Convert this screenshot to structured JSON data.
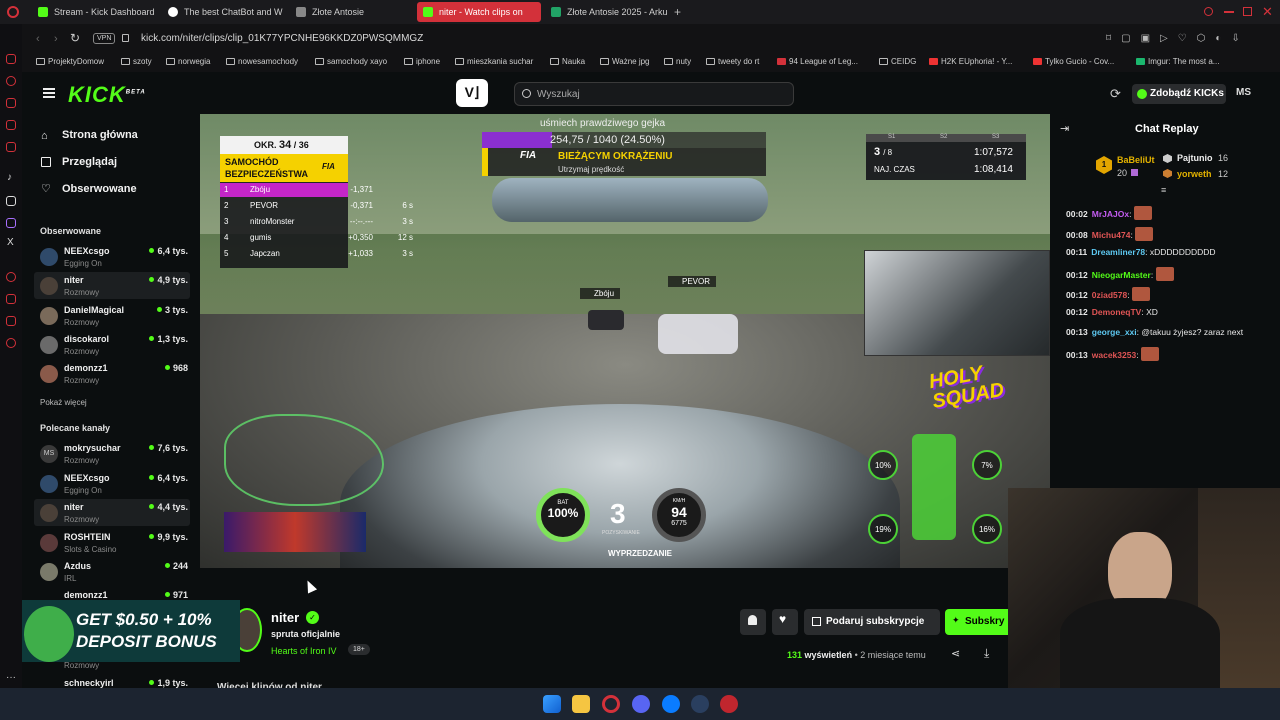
{
  "browser": {
    "tabs": [
      {
        "label": "Stream - Kick Dashboard",
        "color": "#53fc18",
        "active": false
      },
      {
        "label": "The best ChatBot and W",
        "color": "#ffffff",
        "active": false
      },
      {
        "label": "Złote Antosie",
        "color": "#d6d6d6",
        "active": false
      },
      {
        "label": "niter - Watch clips on",
        "color": "#53fc18",
        "active": true
      },
      {
        "label": "Złote Antosie 2025 - Arku",
        "color": "#21a366",
        "active": false
      }
    ],
    "new_tab": "+",
    "vpn": "VPN",
    "url": "kick.com/niter/clips/clip_01K77YPCNHE96KKDZ0PWSQMMGZ",
    "bookmarks": [
      "ProjektyDomow",
      "szoty",
      "norwegia",
      "nowesamochody",
      "samochody xayo",
      "iphone",
      "mieszkania suchar",
      "Nauka",
      "Ważne jpg",
      "nuty",
      "tweety do rt",
      "94 League of Leg...",
      "CEIDG",
      "H2K EUphoria! - Y...",
      "Tylko Gucio - Cov...",
      "Imgur: The most a..."
    ]
  },
  "header": {
    "logo": "KICK",
    "logo_badge": "BETA",
    "search_placeholder": "Wyszukaj",
    "kicks_button": "Zdobądź KICKs",
    "avatar_initials": "MS"
  },
  "sidebar": {
    "nav": [
      "Strona główna",
      "Przeglądaj",
      "Obserwowane"
    ],
    "followed_title": "Obserwowane",
    "followed": [
      {
        "name": "NEEXcsgo",
        "category": "Egging On",
        "viewers": "6,4 tys."
      },
      {
        "name": "niter",
        "category": "Rozmowy",
        "viewers": "4,9 tys."
      },
      {
        "name": "DanielMagical",
        "category": "Rozmowy",
        "viewers": "3 tys."
      },
      {
        "name": "discokarol",
        "category": "Rozmowy",
        "viewers": "1,3 tys."
      },
      {
        "name": "demonzz1",
        "category": "Rozmowy",
        "viewers": "968"
      }
    ],
    "show_more": "Pokaż więcej",
    "recommended_title": "Polecane kanały",
    "recommended": [
      {
        "name": "mokrysuchar",
        "category": "Rozmowy",
        "viewers": "7,6 tys."
      },
      {
        "name": "NEEXcsgo",
        "category": "Egging On",
        "viewers": "6,4 tys."
      },
      {
        "name": "niter",
        "category": "Rozmowy",
        "viewers": "4,4 tys."
      },
      {
        "name": "ROSHTEIN",
        "category": "Slots & Casino",
        "viewers": "9,9 tys."
      },
      {
        "name": "Azdus",
        "category": "IRL",
        "viewers": "244"
      },
      {
        "name": "demonzz1",
        "category": "Rozmowy",
        "viewers": "971"
      },
      {
        "name": "schneckyirl",
        "category": "",
        "viewers": "1,9 tys."
      }
    ]
  },
  "ad": {
    "line1": "GET $0.50 + 10%",
    "line2": "DEPOSIT BONUS"
  },
  "video": {
    "lap_label": "OKR.",
    "lap": "34",
    "lap_total": "/ 36",
    "safety_car": "SAMOCHÓD BEZPIECZEŃSTWA",
    "alert_top": "uśmiech prawdziwego gejka",
    "alert_amount": "254,75 / 1040 (24.50%)",
    "alert_title": "BIEŻĄCYM OKRĄŻENIU",
    "alert_sub": "Utrzymaj prędkość",
    "standings": [
      {
        "pos": "1",
        "name": "Zbóju",
        "gap": "-1,371",
        "tyre": ""
      },
      {
        "pos": "2",
        "name": "PEVOR",
        "gap": "-0,371",
        "tyre": "6 s"
      },
      {
        "pos": "3",
        "name": "nitroMonster",
        "gap": "--:--.---",
        "tyre": "3 s"
      },
      {
        "pos": "4",
        "name": "gumis",
        "gap": "+0,350",
        "tyre": "12 s"
      },
      {
        "pos": "5",
        "name": "Japczan",
        "gap": "+1,033",
        "tyre": "3 s"
      }
    ],
    "sectors": [
      "S1",
      "S2",
      "S3"
    ],
    "position": "3",
    "position_total": "/ 8",
    "lap_time": "1:07,572",
    "best_label": "NAJ. CZAS",
    "best_time": "1:08,414",
    "car_tag_1": "PEVOR",
    "car_tag_2": "Zbóju",
    "battery": "100%",
    "battery_label": "BAT",
    "gear": "3",
    "speed": "94",
    "speed_unit": "KM/H",
    "rpm": "6775",
    "ers_mode": "POZYSKIWANIE",
    "overtake": "WYPRZEDZANIE",
    "tyre_wear": [
      "10%",
      "7%",
      "19%",
      "16%"
    ],
    "team_logo": "HOLY SQUAD"
  },
  "chat": {
    "title": "Chat Replay",
    "gifters": [
      {
        "name": "BaBeliUt",
        "count": "20"
      },
      {
        "name": "Pajtunio",
        "count": "16"
      },
      {
        "name": "yorweth",
        "count": "12"
      }
    ],
    "messages": [
      {
        "time": "00:02",
        "user": "MrJAJOx",
        "color": "#c45cf2",
        "text": ""
      },
      {
        "time": "00:08",
        "user": "Michu474",
        "color": "#e05555",
        "text": ""
      },
      {
        "time": "00:11",
        "user": "Dreamliner78",
        "color": "#5ec9f2",
        "text": "xDDDDDDDDDD"
      },
      {
        "time": "00:12",
        "user": "NieogarMaster",
        "color": "#53fc18",
        "text": ""
      },
      {
        "time": "00:12",
        "user": "0ziad578",
        "color": "#e05555",
        "text": ""
      },
      {
        "time": "00:12",
        "user": "DemoneqTV",
        "color": "#e05555",
        "text": "XD"
      },
      {
        "time": "00:13",
        "user": "george_xxi",
        "color": "#5ec9f2",
        "text": "@takuu żyjesz? zaraz next"
      },
      {
        "time": "00:13",
        "user": "wacek3253",
        "color": "#e05555",
        "text": ""
      }
    ]
  },
  "info": {
    "channel": "niter",
    "clip_title": "spruta oficjalnie",
    "category": "Hearts of Iron IV",
    "age_badge": "18+",
    "gift_button": "Podaruj subskrypcje",
    "subscribe_button": "Subskry",
    "views_count": "131",
    "views_label": "wyświetleń",
    "age": "2 miesiące temu",
    "more_clips": "Więcej klipów od niter"
  },
  "colors": {
    "accent": "#53fc18",
    "tab_active": "#d3313a",
    "bg": "#0b0e0f"
  }
}
